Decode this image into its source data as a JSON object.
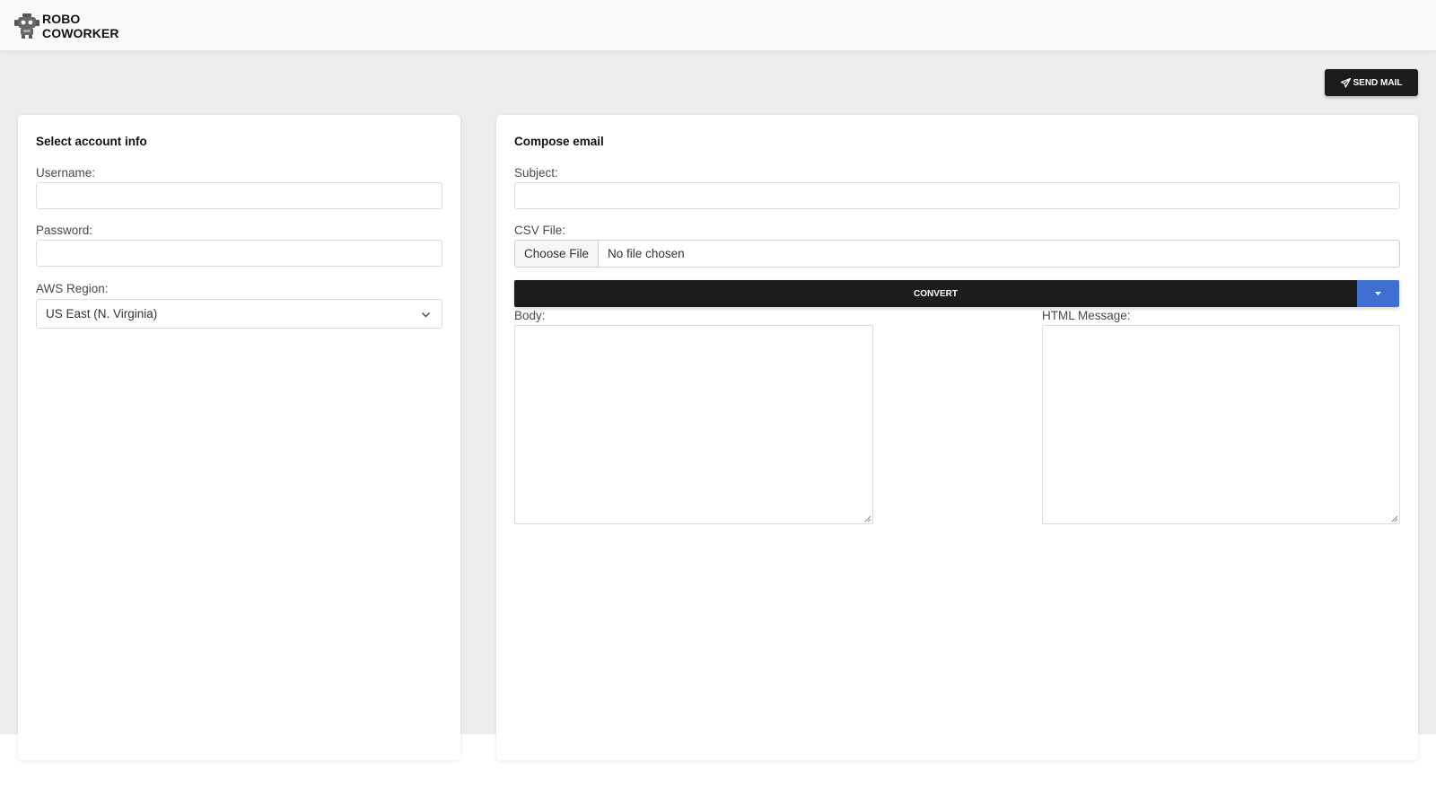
{
  "header": {
    "brand_line1": "ROBO",
    "brand_line2": "COWORKER",
    "logo_icon": "robot-icon"
  },
  "toolbar": {
    "send_label": "SEND MAIL",
    "send_icon": "paper-plane-icon"
  },
  "account": {
    "title": "Select account info",
    "username_label": "Username:",
    "username_value": "",
    "password_label": "Password:",
    "password_value": "",
    "region_label": "AWS Region:",
    "region_value": "US East (N. Virginia)"
  },
  "compose": {
    "title": "Compose email",
    "subject_label": "Subject:",
    "subject_value": "",
    "csv_label": "CSV File:",
    "choose_file_label": "Choose File",
    "file_status": "No file chosen",
    "convert_label": "CONVERT",
    "body_label": "Body:",
    "body_value": "",
    "html_label": "HTML Message:",
    "html_value": ""
  },
  "colors": {
    "accent_blue": "#3f6fd0",
    "button_dark": "#1c1c1c",
    "background_grey": "#eeeded"
  }
}
